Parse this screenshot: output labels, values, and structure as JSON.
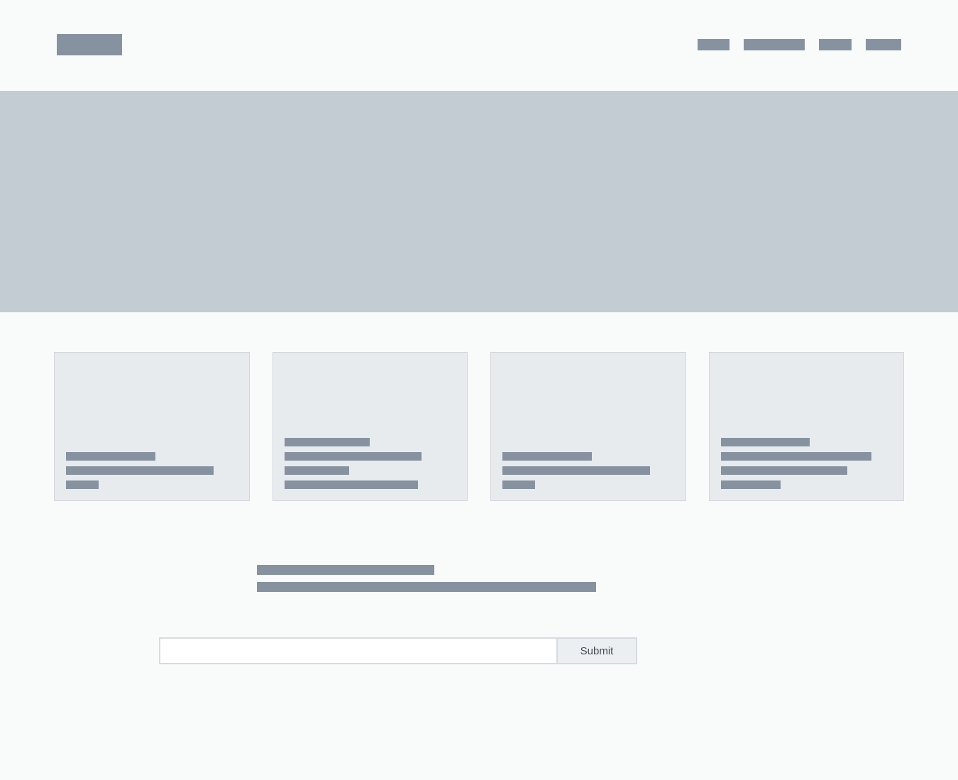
{
  "form": {
    "submit_label": "Submit",
    "input_value": ""
  }
}
